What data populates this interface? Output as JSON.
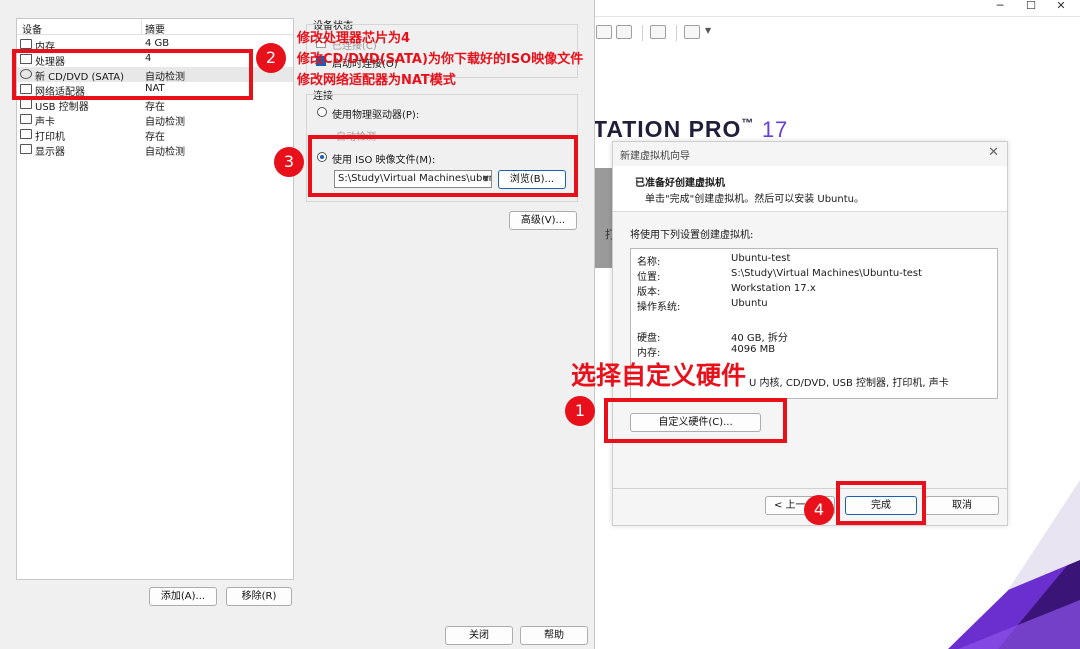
{
  "background_app": {
    "brand_prefix": "TATION PRO",
    "brand_tm": "™",
    "brand_version": "17",
    "side_fragment": "打",
    "window_controls": [
      "─",
      "☐",
      "✕"
    ]
  },
  "settings": {
    "list_header": {
      "device": "设备",
      "summary": "摘要"
    },
    "devices": [
      {
        "name": "内存",
        "value": "4 GB",
        "icon": "memory-icon"
      },
      {
        "name": "处理器",
        "value": "4",
        "icon": "cpu-icon"
      },
      {
        "name": "新 CD/DVD (SATA)",
        "value": "自动检测",
        "icon": "cd-icon"
      },
      {
        "name": "网络适配器",
        "value": "NAT",
        "icon": "network-icon"
      },
      {
        "name": "USB 控制器",
        "value": "存在",
        "icon": "usb-icon"
      },
      {
        "name": "声卡",
        "value": "自动检测",
        "icon": "speaker-icon"
      },
      {
        "name": "打印机",
        "value": "存在",
        "icon": "printer-icon"
      },
      {
        "name": "显示器",
        "value": "自动检测",
        "icon": "monitor-icon"
      }
    ],
    "add_button": "添加(A)...",
    "remove_button": "移除(R)",
    "device_status_label": "设备状态",
    "status_connected": "已连接(C)",
    "status_connect_on_power": "启动时连接(O)",
    "connection_label": "连接",
    "physical_drive_option": "使用物理驱动器(P):",
    "physical_drive_value": "自动检测",
    "iso_option": "使用 ISO 映像文件(M):",
    "iso_path": "S:\\Study\\Virtual Machines\\ubun",
    "browse_button": "浏览(B)...",
    "advanced_button": "高级(V)...",
    "close_button": "关闭",
    "help_button": "帮助"
  },
  "wizard": {
    "title": "新建虚拟机向导",
    "close_glyph": "✕",
    "heading": "已准备好创建虚拟机",
    "subheading": "单击\"完成\"创建虚拟机。然后可以安装 Ubuntu。",
    "summary_intro": "将使用下列设置创建虚拟机:",
    "summary_rows": [
      {
        "k": "名称:",
        "v": "Ubuntu-test"
      },
      {
        "k": "位置:",
        "v": "S:\\Study\\Virtual Machines\\Ubuntu-test"
      },
      {
        "k": "版本:",
        "v": "Workstation 17.x"
      },
      {
        "k": "操作系统:",
        "v": "Ubuntu"
      },
      {
        "k": "",
        "v": ""
      },
      {
        "k": "硬盘:",
        "v": "40 GB, 拆分"
      },
      {
        "k": "内存:",
        "v": "4096 MB"
      },
      {
        "k": "",
        "v": ""
      },
      {
        "k": "",
        "v": "U 内核, CD/DVD, USB 控制器, 打印机, 声卡"
      }
    ],
    "customize_button": "自定义硬件(C)...",
    "back_button": "< 上一",
    "finish_button": "完成",
    "cancel_button": "取消"
  },
  "annotations": {
    "badge_1": "1",
    "badge_2": "2",
    "badge_3": "3",
    "badge_4": "4",
    "note_customize": "选择自定义硬件",
    "note_lines": [
      "修改处理器芯片为4",
      "修改CD/DVD(SATA)为你下载好的ISO映像文件",
      "修改网络适配器为NAT模式"
    ],
    "red": "#e8101a"
  }
}
